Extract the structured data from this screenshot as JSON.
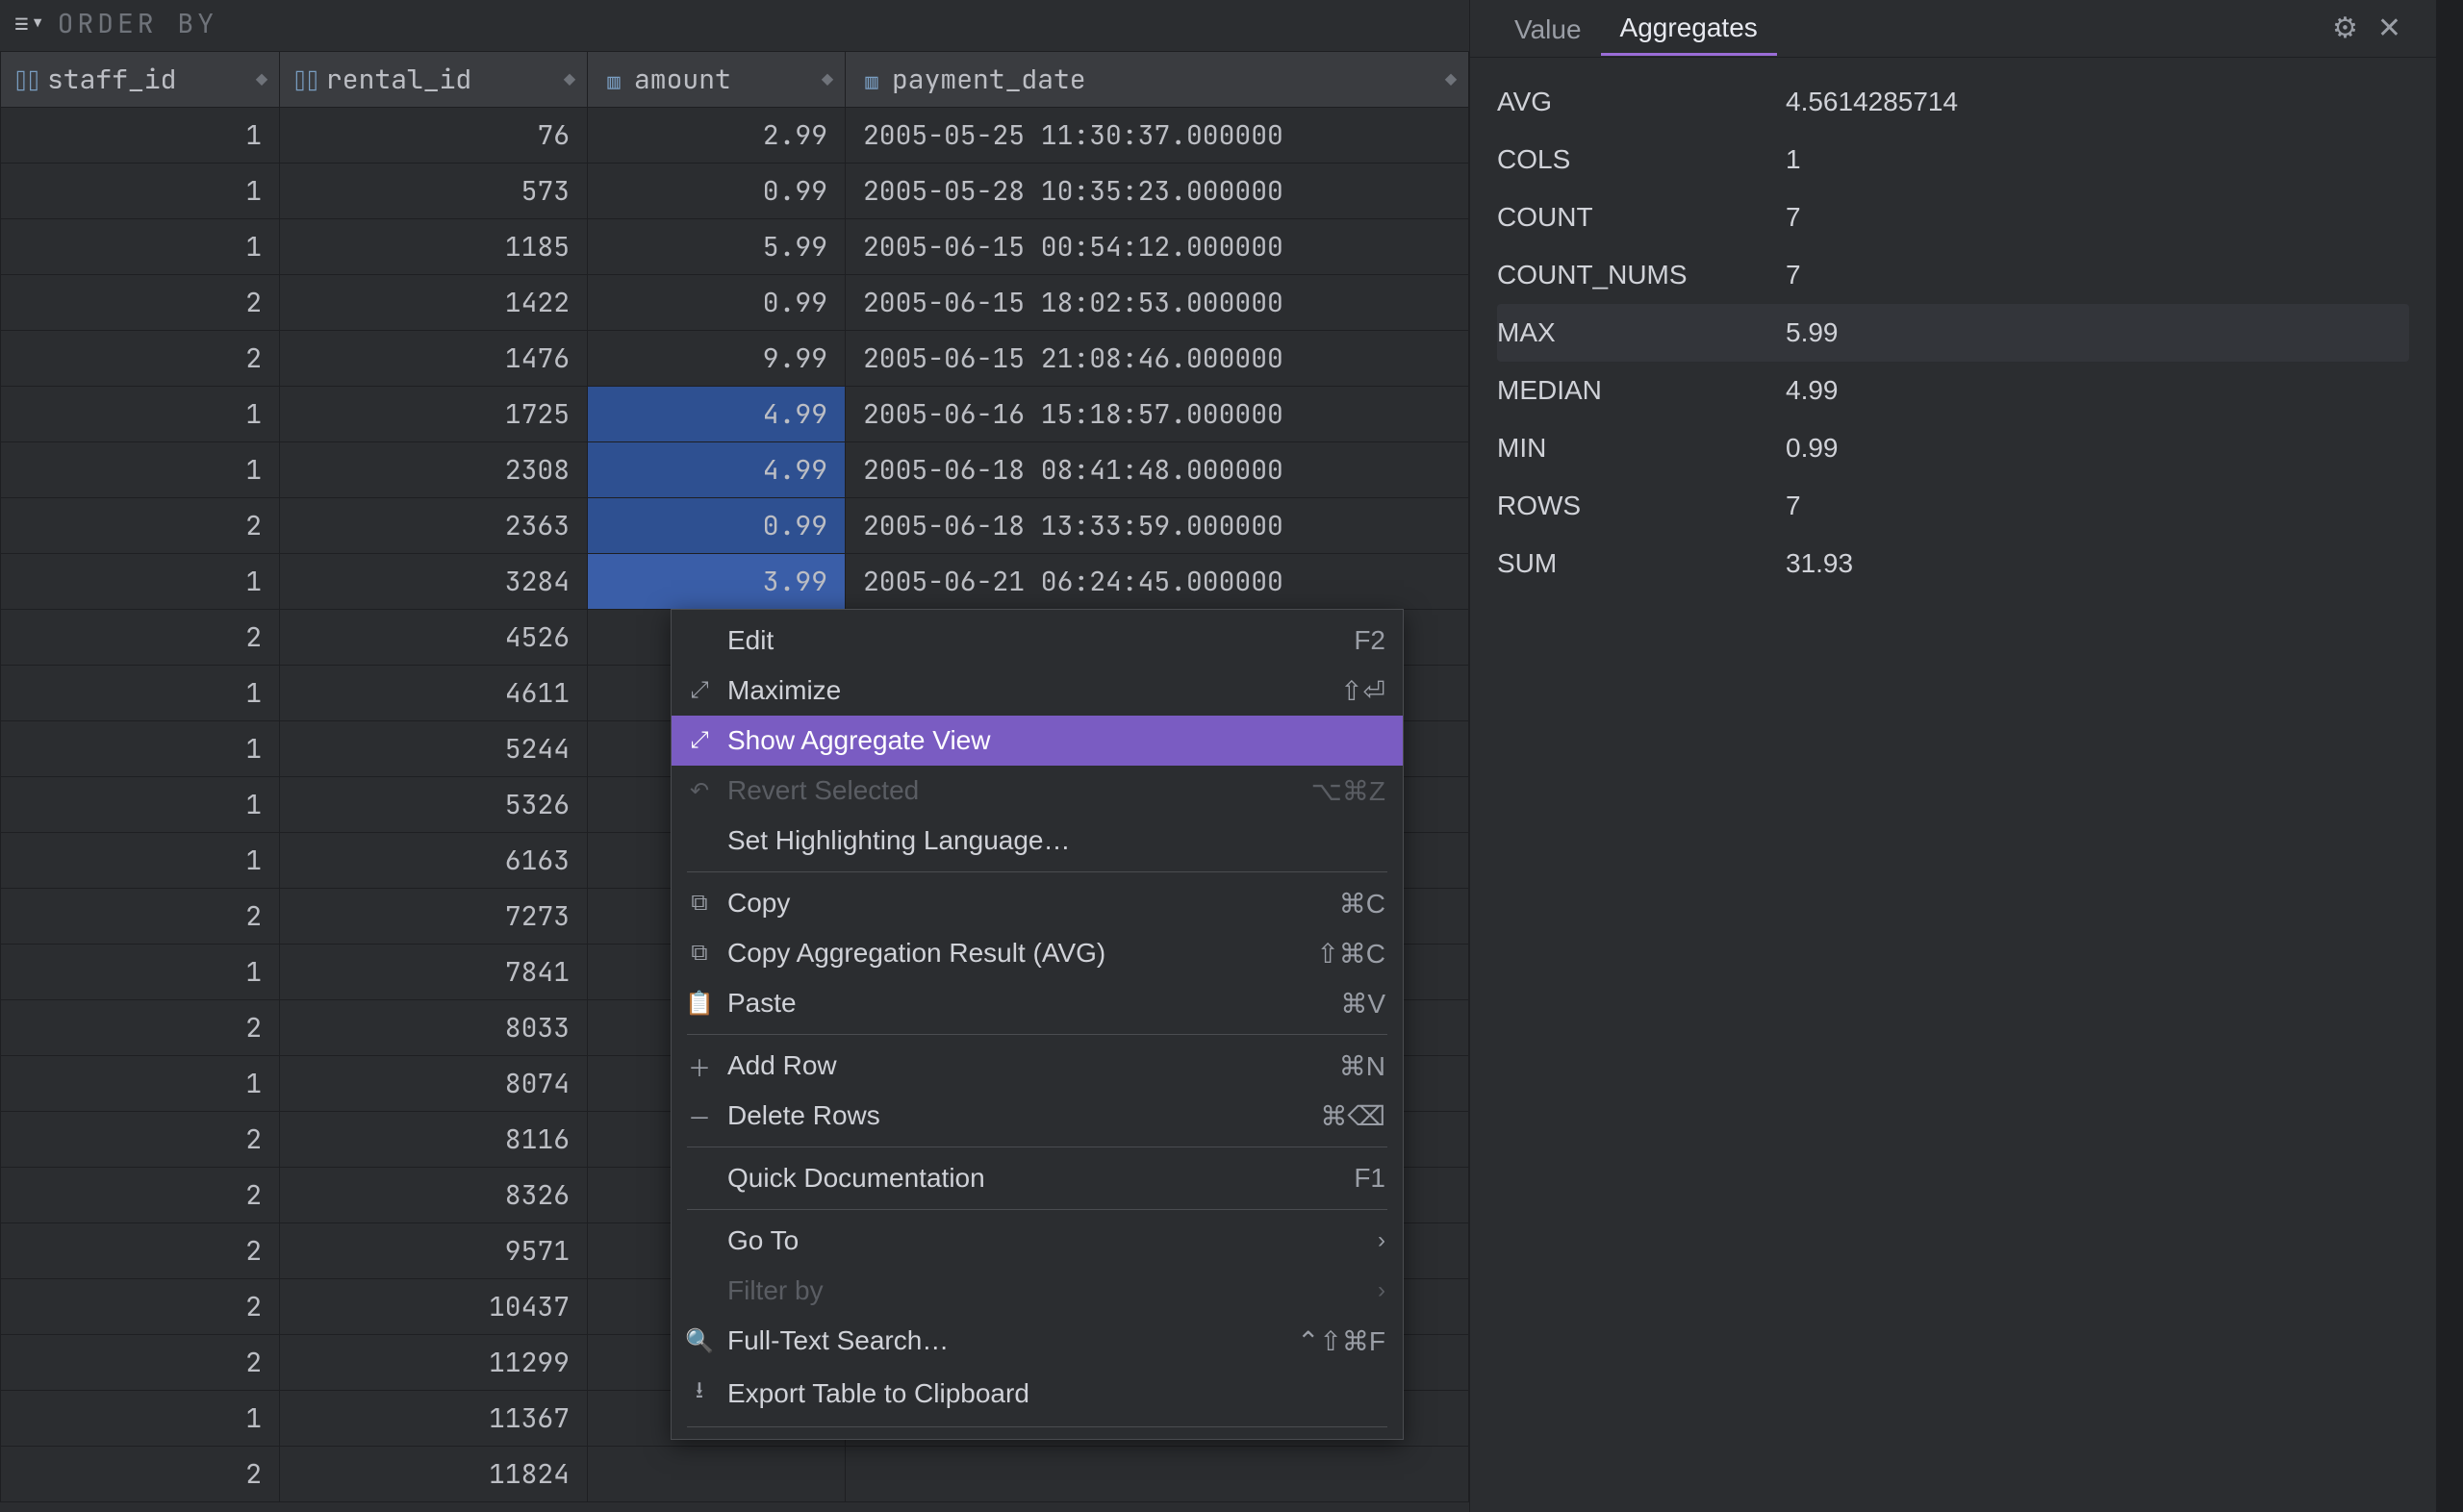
{
  "orderby": {
    "label": "ORDER BY"
  },
  "columns": [
    {
      "name": "staff_id",
      "icon": "key"
    },
    {
      "name": "rental_id",
      "icon": "key"
    },
    {
      "name": "amount",
      "icon": "col"
    },
    {
      "name": "payment_date",
      "icon": "col"
    }
  ],
  "rows": [
    {
      "staff_id": "1",
      "rental_id": "76",
      "amount": "2.99",
      "payment_date": "2005-05-25 11:30:37.000000"
    },
    {
      "staff_id": "1",
      "rental_id": "573",
      "amount": "0.99",
      "payment_date": "2005-05-28 10:35:23.000000"
    },
    {
      "staff_id": "1",
      "rental_id": "1185",
      "amount": "5.99",
      "payment_date": "2005-06-15 00:54:12.000000"
    },
    {
      "staff_id": "2",
      "rental_id": "1422",
      "amount": "0.99",
      "payment_date": "2005-06-15 18:02:53.000000"
    },
    {
      "staff_id": "2",
      "rental_id": "1476",
      "amount": "9.99",
      "payment_date": "2005-06-15 21:08:46.000000"
    },
    {
      "staff_id": "1",
      "rental_id": "1725",
      "amount": "4.99",
      "payment_date": "2005-06-16 15:18:57.000000",
      "sel": true
    },
    {
      "staff_id": "1",
      "rental_id": "2308",
      "amount": "4.99",
      "payment_date": "2005-06-18 08:41:48.000000",
      "sel": true
    },
    {
      "staff_id": "2",
      "rental_id": "2363",
      "amount": "0.99",
      "payment_date": "2005-06-18 13:33:59.000000",
      "sel": true
    },
    {
      "staff_id": "1",
      "rental_id": "3284",
      "amount": "3.99",
      "payment_date": "2005-06-21 06:24:45.000000",
      "sel": true,
      "active": true
    },
    {
      "staff_id": "2",
      "rental_id": "4526",
      "amount": "",
      "payment_date": ""
    },
    {
      "staff_id": "1",
      "rental_id": "4611",
      "amount": "",
      "payment_date": ""
    },
    {
      "staff_id": "1",
      "rental_id": "5244",
      "amount": "",
      "payment_date": ""
    },
    {
      "staff_id": "1",
      "rental_id": "5326",
      "amount": "",
      "payment_date": ""
    },
    {
      "staff_id": "1",
      "rental_id": "6163",
      "amount": "",
      "payment_date": ""
    },
    {
      "staff_id": "2",
      "rental_id": "7273",
      "amount": "",
      "payment_date": ""
    },
    {
      "staff_id": "1",
      "rental_id": "7841",
      "amount": "",
      "payment_date": ""
    },
    {
      "staff_id": "2",
      "rental_id": "8033",
      "amount": "",
      "payment_date": ""
    },
    {
      "staff_id": "1",
      "rental_id": "8074",
      "amount": "",
      "payment_date": ""
    },
    {
      "staff_id": "2",
      "rental_id": "8116",
      "amount": "",
      "payment_date": ""
    },
    {
      "staff_id": "2",
      "rental_id": "8326",
      "amount": "",
      "payment_date": ""
    },
    {
      "staff_id": "2",
      "rental_id": "9571",
      "amount": "",
      "payment_date": ""
    },
    {
      "staff_id": "2",
      "rental_id": "10437",
      "amount": "",
      "payment_date": ""
    },
    {
      "staff_id": "2",
      "rental_id": "11299",
      "amount": "",
      "payment_date": ""
    },
    {
      "staff_id": "1",
      "rental_id": "11367",
      "amount": "",
      "payment_date": ""
    },
    {
      "staff_id": "2",
      "rental_id": "11824",
      "amount": "",
      "payment_date": ""
    }
  ],
  "ctx": {
    "edit": {
      "label": "Edit",
      "accel": "F2"
    },
    "maximize": {
      "label": "Maximize",
      "accel": "⇧⏎"
    },
    "show_agg": {
      "label": "Show Aggregate View"
    },
    "revert": {
      "label": "Revert Selected",
      "accel": "⌥⌘Z"
    },
    "set_hl": {
      "label": "Set Highlighting Language…"
    },
    "copy": {
      "label": "Copy",
      "accel": "⌘C"
    },
    "copy_agg": {
      "label": "Copy Aggregation Result (AVG)",
      "accel": "⇧⌘C"
    },
    "paste": {
      "label": "Paste",
      "accel": "⌘V"
    },
    "add_row": {
      "label": "Add Row",
      "accel": "⌘N"
    },
    "delete_rows": {
      "label": "Delete Rows",
      "accel": "⌘⌫"
    },
    "quick_doc": {
      "label": "Quick Documentation",
      "accel": "F1"
    },
    "go_to": {
      "label": "Go To"
    },
    "filter_by": {
      "label": "Filter by"
    },
    "fts": {
      "label": "Full-Text Search…",
      "accel": "⌃⇧⌘F"
    },
    "export": {
      "label": "Export Table to Clipboard"
    }
  },
  "side": {
    "tabs": {
      "value": "Value",
      "aggregates": "Aggregates"
    },
    "stats": [
      {
        "k": "AVG",
        "v": "4.5614285714"
      },
      {
        "k": "COLS",
        "v": "1"
      },
      {
        "k": "COUNT",
        "v": "7"
      },
      {
        "k": "COUNT_NUMS",
        "v": "7"
      },
      {
        "k": "MAX",
        "v": "5.99",
        "hover": true
      },
      {
        "k": "MEDIAN",
        "v": "4.99"
      },
      {
        "k": "MIN",
        "v": "0.99"
      },
      {
        "k": "ROWS",
        "v": "7"
      },
      {
        "k": "SUM",
        "v": "31.93"
      }
    ]
  }
}
